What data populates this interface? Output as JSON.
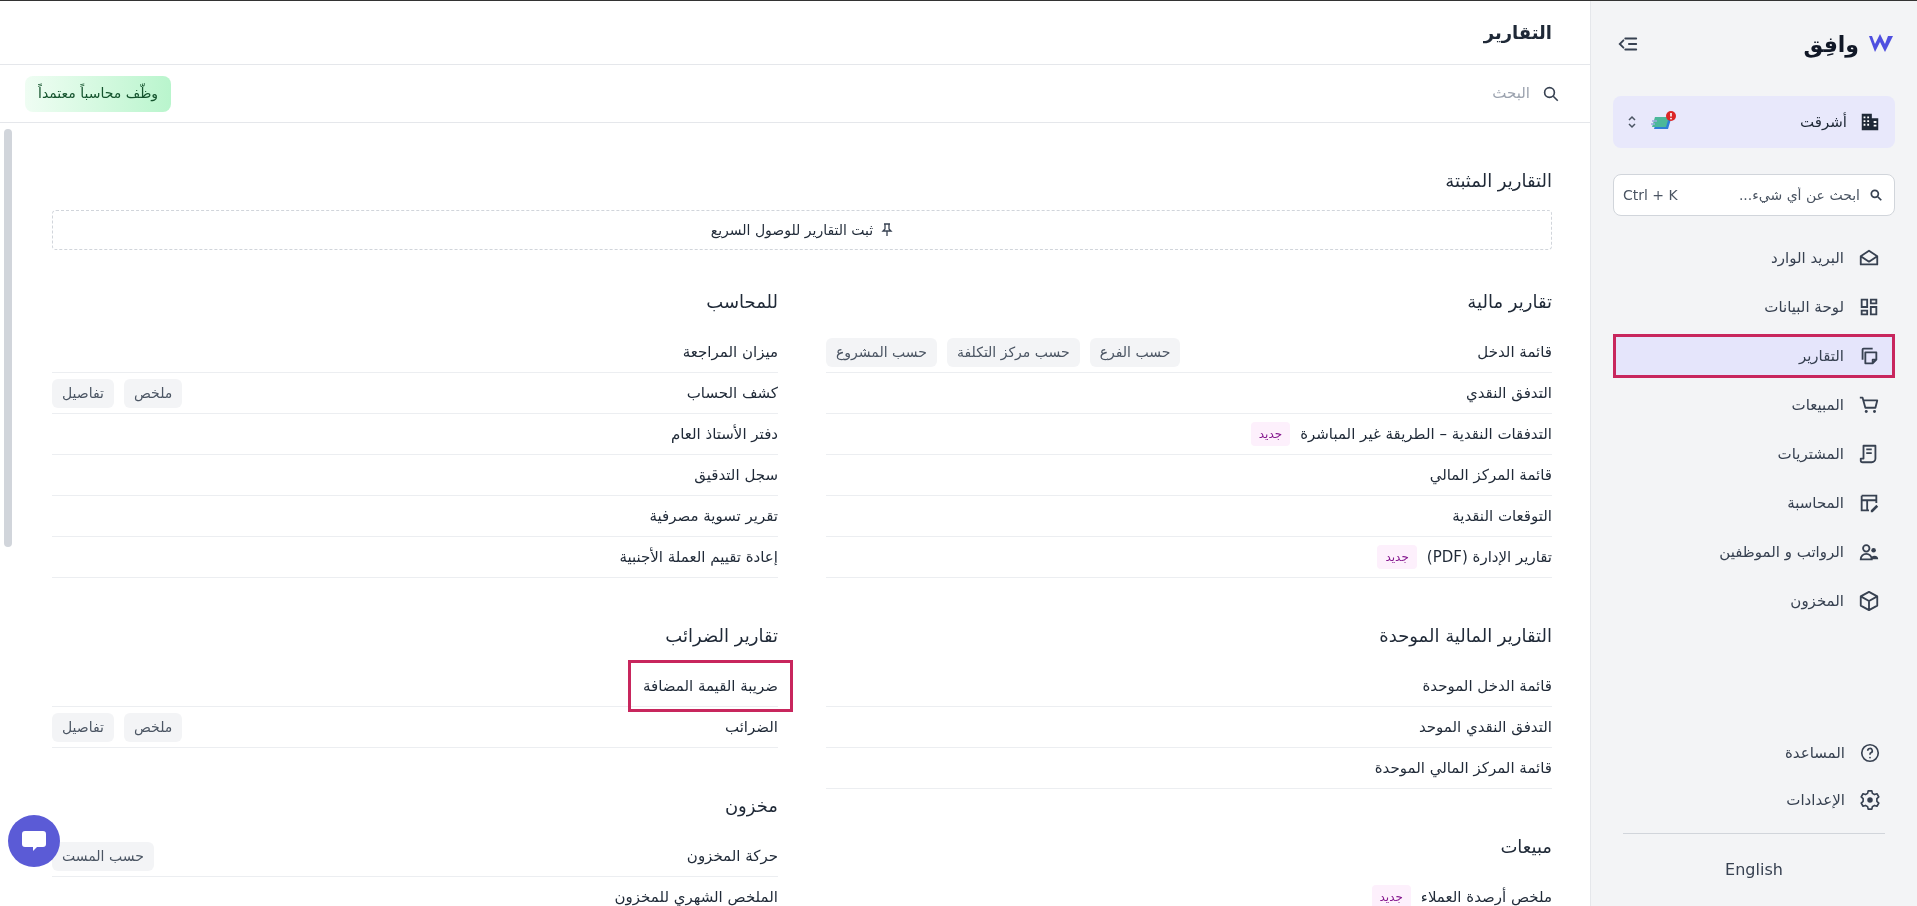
{
  "sidebar": {
    "logo": "وافِق",
    "company": {
      "name": "أشرقت"
    },
    "search": {
      "placeholder": "ابحث عن أي شيء...",
      "shortcut": "Ctrl + K"
    },
    "items": [
      {
        "label": "البريد الوارد",
        "selected": false,
        "highlighted": false
      },
      {
        "label": "لوحة البيانات",
        "selected": false,
        "highlighted": false
      },
      {
        "label": "التقارير",
        "selected": true,
        "highlighted": true
      },
      {
        "label": "المبيعات",
        "selected": false,
        "highlighted": false
      },
      {
        "label": "المشتريات",
        "selected": false,
        "highlighted": false
      },
      {
        "label": "المحاسبة",
        "selected": false,
        "highlighted": false
      },
      {
        "label": "الرواتب و الموظفين",
        "selected": false,
        "highlighted": false
      },
      {
        "label": "المخزون",
        "selected": false,
        "highlighted": false
      }
    ],
    "bottom_items": [
      {
        "label": "المساعدة"
      },
      {
        "label": "الإعدادات"
      }
    ],
    "language": "English"
  },
  "header": {
    "title": "التقارير"
  },
  "toolbar": {
    "search": {
      "placeholder": "البحث"
    },
    "promo_button": "وظّف محاسباً معتمداً"
  },
  "pinned": {
    "title": "التقارير المثبتة",
    "hint": "ثبت التقارير للوصول السريع"
  },
  "columns": [
    {
      "sections": [
        {
          "title": "تقارير مالية",
          "rows": [
            {
              "label": "قائمة الدخل",
              "chips": [
                "حسب الفرع",
                "حسب مركز التكلفة",
                "حسب المشروع"
              ],
              "highlighted": false
            },
            {
              "label": "التدفق النقدي",
              "highlighted": false
            },
            {
              "label": "التدفقات النقدية – الطريقة غير المباشرة",
              "badge": "جديد",
              "highlighted": false
            },
            {
              "label": "قائمة المركز المالي",
              "highlighted": false
            },
            {
              "label": "التوقعات النقدية",
              "highlighted": false
            },
            {
              "label": "تقارير الإدارة (PDF)",
              "badge": "جديد",
              "highlighted": false
            }
          ]
        },
        {
          "title": "التقارير المالية الموحدة",
          "rows": [
            {
              "label": "قائمة الدخل الموحدة",
              "highlighted": false
            },
            {
              "label": "التدفق النقدي الموحد",
              "highlighted": false
            },
            {
              "label": "قائمة المركز المالي الموحدة",
              "highlighted": false
            }
          ]
        },
        {
          "title": "مبيعات",
          "rows": [
            {
              "label": "ملخص أرصدة العملاء",
              "badge": "جديد",
              "highlighted": false
            }
          ]
        }
      ]
    },
    {
      "sections": [
        {
          "title": "للمحاسب",
          "rows": [
            {
              "label": "ميزان المراجعة",
              "highlighted": false
            },
            {
              "label": "كشف الحساب",
              "chips": [
                "ملخص",
                "تفاصيل"
              ],
              "highlighted": false
            },
            {
              "label": "دفتر الأستاذ العام",
              "highlighted": false
            },
            {
              "label": "سجل التدقيق",
              "highlighted": false
            },
            {
              "label": "تقرير تسوية مصرفية",
              "highlighted": false
            },
            {
              "label": "إعادة تقييم العملة الأجنبية",
              "highlighted": false
            }
          ]
        },
        {
          "title": "تقارير الضرائب",
          "rows": [
            {
              "label": "ضريبة القيمة المضافة",
              "highlighted": true
            },
            {
              "label": "الضرائب",
              "chips": [
                "ملخص",
                "تفاصيل"
              ],
              "highlighted": false
            }
          ]
        },
        {
          "title": "مخزون",
          "rows": [
            {
              "label": "حركة المخزون",
              "chips": [
                "حسب المست"
              ],
              "highlighted": false
            },
            {
              "label": "الملخص الشهري للمخزون",
              "highlighted": false
            }
          ]
        }
      ]
    }
  ]
}
